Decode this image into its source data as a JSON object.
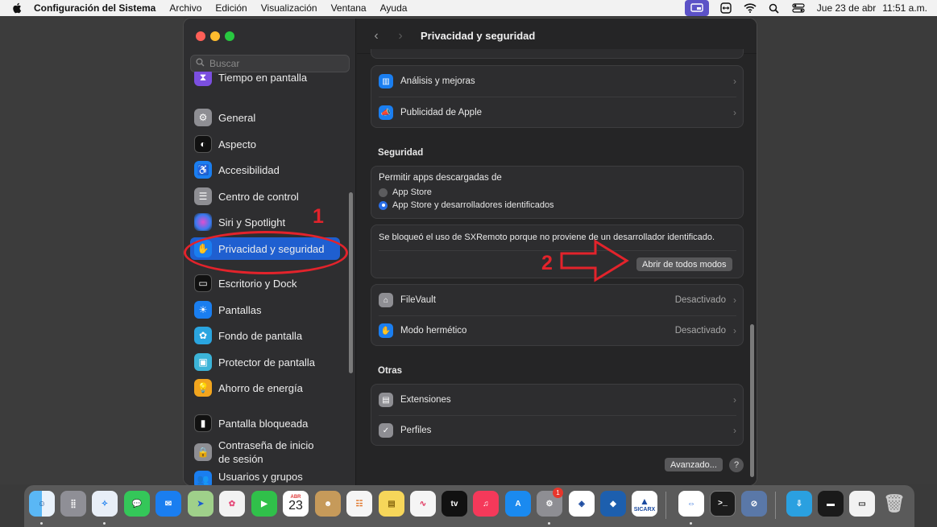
{
  "menubar": {
    "app_name": "Configuración del Sistema",
    "menus": [
      "Archivo",
      "Edición",
      "Visualización",
      "Ventana",
      "Ayuda"
    ],
    "date": "Jue 23 de abr",
    "time": "11:51 a.m."
  },
  "sidebar": {
    "search_placeholder": "Buscar",
    "items": [
      {
        "label": "Tiempo en pantalla",
        "icon": "hourglass-icon",
        "color": "#7b4fe0"
      },
      {
        "label": "General",
        "icon": "gear-icon",
        "color": "#8e8e93"
      },
      {
        "label": "Aspecto",
        "icon": "appearance-icon",
        "color": "#111111"
      },
      {
        "label": "Accesibilidad",
        "icon": "accessibility-icon",
        "color": "#1a7ef0"
      },
      {
        "label": "Centro de control",
        "icon": "control-center-icon",
        "color": "#8e8e93"
      },
      {
        "label": "Siri y Spotlight",
        "icon": "siri-icon",
        "color": "#2a2a2a"
      },
      {
        "label": "Privacidad y seguridad",
        "icon": "hand-icon",
        "color": "#1a7ef0"
      },
      {
        "label": "Escritorio y Dock",
        "icon": "dock-icon",
        "color": "#111111"
      },
      {
        "label": "Pantallas",
        "icon": "sun-icon",
        "color": "#1a7ef0"
      },
      {
        "label": "Fondo de pantalla",
        "icon": "wallpaper-icon",
        "color": "#2aa5e0"
      },
      {
        "label": "Protector de pantalla",
        "icon": "screensaver-icon",
        "color": "#3cb4d8"
      },
      {
        "label": "Ahorro de energía",
        "icon": "bulb-icon",
        "color": "#f2a51e"
      },
      {
        "label": "Pantalla bloqueada",
        "icon": "lock-screen-icon",
        "color": "#111111"
      },
      {
        "label": "Contraseña de inicio de sesión",
        "label_line1": "Contraseña de inicio",
        "label_line2": "de sesión",
        "icon": "lock-icon",
        "color": "#8e8e93"
      },
      {
        "label": "Usuarios y grupos",
        "icon": "users-icon",
        "color": "#1a7ef0"
      }
    ]
  },
  "annotations": {
    "one": "1",
    "two": "2"
  },
  "main": {
    "title": "Privacidad y seguridad",
    "top_rows": [
      {
        "label": "Análisis y mejoras",
        "icon": "chart-icon",
        "color": "#1a7ef0"
      },
      {
        "label": "Publicidad de Apple",
        "icon": "megaphone-icon",
        "color": "#1a7ef0"
      }
    ],
    "security": {
      "section": "Seguridad",
      "allow_label": "Permitir apps descargadas de",
      "options": [
        "App Store",
        "App Store y desarrolladores identificados"
      ],
      "selected_option": "App Store y desarrolladores identificados",
      "blocked_message": "Se bloqueó el uso de SXRemoto porque no proviene de un desarrollador identificado.",
      "open_button": "Abrir de todos modos",
      "rows": [
        {
          "label": "FileVault",
          "value": "Desactivado",
          "icon": "filevault-icon",
          "color": "#8e8e93"
        },
        {
          "label": "Modo hermético",
          "value": "Desactivado",
          "icon": "hand-icon",
          "color": "#1a7ef0"
        }
      ]
    },
    "others": {
      "section": "Otras",
      "rows": [
        {
          "label": "Extensiones",
          "icon": "extensions-icon",
          "color": "#8e8e93"
        },
        {
          "label": "Perfiles",
          "icon": "checkmark-badge-icon",
          "color": "#8e8e93"
        }
      ]
    },
    "advanced_button": "Avanzado...",
    "help_button": "?"
  },
  "dock": {
    "calendar_month": "ABR",
    "calendar_day": "23",
    "badge_count": "1",
    "sicarx_label": "SICARX"
  }
}
